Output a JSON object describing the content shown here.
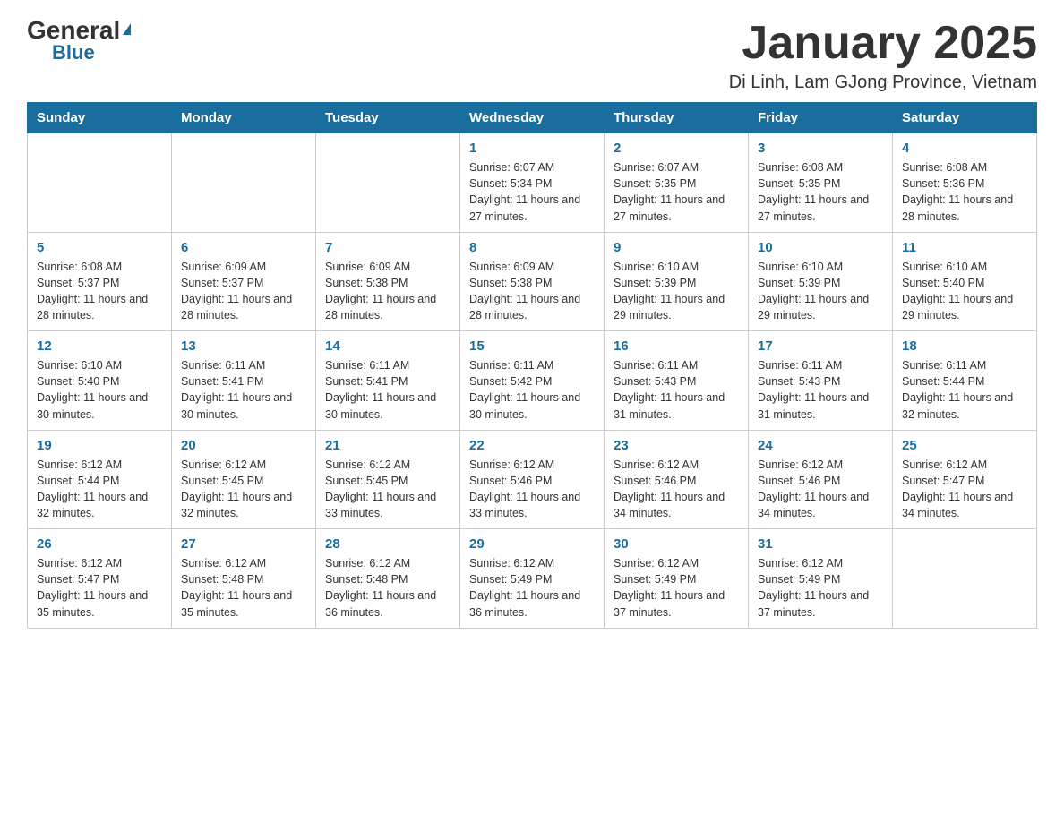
{
  "header": {
    "logo_general": "General",
    "logo_triangle": "▼",
    "logo_blue": "Blue",
    "main_title": "January 2025",
    "subtitle": "Di Linh, Lam GJong Province, Vietnam"
  },
  "calendar": {
    "days_of_week": [
      "Sunday",
      "Monday",
      "Tuesday",
      "Wednesday",
      "Thursday",
      "Friday",
      "Saturday"
    ],
    "weeks": [
      [
        {
          "day": "",
          "info": ""
        },
        {
          "day": "",
          "info": ""
        },
        {
          "day": "",
          "info": ""
        },
        {
          "day": "1",
          "info": "Sunrise: 6:07 AM\nSunset: 5:34 PM\nDaylight: 11 hours and 27 minutes."
        },
        {
          "day": "2",
          "info": "Sunrise: 6:07 AM\nSunset: 5:35 PM\nDaylight: 11 hours and 27 minutes."
        },
        {
          "day": "3",
          "info": "Sunrise: 6:08 AM\nSunset: 5:35 PM\nDaylight: 11 hours and 27 minutes."
        },
        {
          "day": "4",
          "info": "Sunrise: 6:08 AM\nSunset: 5:36 PM\nDaylight: 11 hours and 28 minutes."
        }
      ],
      [
        {
          "day": "5",
          "info": "Sunrise: 6:08 AM\nSunset: 5:37 PM\nDaylight: 11 hours and 28 minutes."
        },
        {
          "day": "6",
          "info": "Sunrise: 6:09 AM\nSunset: 5:37 PM\nDaylight: 11 hours and 28 minutes."
        },
        {
          "day": "7",
          "info": "Sunrise: 6:09 AM\nSunset: 5:38 PM\nDaylight: 11 hours and 28 minutes."
        },
        {
          "day": "8",
          "info": "Sunrise: 6:09 AM\nSunset: 5:38 PM\nDaylight: 11 hours and 28 minutes."
        },
        {
          "day": "9",
          "info": "Sunrise: 6:10 AM\nSunset: 5:39 PM\nDaylight: 11 hours and 29 minutes."
        },
        {
          "day": "10",
          "info": "Sunrise: 6:10 AM\nSunset: 5:39 PM\nDaylight: 11 hours and 29 minutes."
        },
        {
          "day": "11",
          "info": "Sunrise: 6:10 AM\nSunset: 5:40 PM\nDaylight: 11 hours and 29 minutes."
        }
      ],
      [
        {
          "day": "12",
          "info": "Sunrise: 6:10 AM\nSunset: 5:40 PM\nDaylight: 11 hours and 30 minutes."
        },
        {
          "day": "13",
          "info": "Sunrise: 6:11 AM\nSunset: 5:41 PM\nDaylight: 11 hours and 30 minutes."
        },
        {
          "day": "14",
          "info": "Sunrise: 6:11 AM\nSunset: 5:41 PM\nDaylight: 11 hours and 30 minutes."
        },
        {
          "day": "15",
          "info": "Sunrise: 6:11 AM\nSunset: 5:42 PM\nDaylight: 11 hours and 30 minutes."
        },
        {
          "day": "16",
          "info": "Sunrise: 6:11 AM\nSunset: 5:43 PM\nDaylight: 11 hours and 31 minutes."
        },
        {
          "day": "17",
          "info": "Sunrise: 6:11 AM\nSunset: 5:43 PM\nDaylight: 11 hours and 31 minutes."
        },
        {
          "day": "18",
          "info": "Sunrise: 6:11 AM\nSunset: 5:44 PM\nDaylight: 11 hours and 32 minutes."
        }
      ],
      [
        {
          "day": "19",
          "info": "Sunrise: 6:12 AM\nSunset: 5:44 PM\nDaylight: 11 hours and 32 minutes."
        },
        {
          "day": "20",
          "info": "Sunrise: 6:12 AM\nSunset: 5:45 PM\nDaylight: 11 hours and 32 minutes."
        },
        {
          "day": "21",
          "info": "Sunrise: 6:12 AM\nSunset: 5:45 PM\nDaylight: 11 hours and 33 minutes."
        },
        {
          "day": "22",
          "info": "Sunrise: 6:12 AM\nSunset: 5:46 PM\nDaylight: 11 hours and 33 minutes."
        },
        {
          "day": "23",
          "info": "Sunrise: 6:12 AM\nSunset: 5:46 PM\nDaylight: 11 hours and 34 minutes."
        },
        {
          "day": "24",
          "info": "Sunrise: 6:12 AM\nSunset: 5:46 PM\nDaylight: 11 hours and 34 minutes."
        },
        {
          "day": "25",
          "info": "Sunrise: 6:12 AM\nSunset: 5:47 PM\nDaylight: 11 hours and 34 minutes."
        }
      ],
      [
        {
          "day": "26",
          "info": "Sunrise: 6:12 AM\nSunset: 5:47 PM\nDaylight: 11 hours and 35 minutes."
        },
        {
          "day": "27",
          "info": "Sunrise: 6:12 AM\nSunset: 5:48 PM\nDaylight: 11 hours and 35 minutes."
        },
        {
          "day": "28",
          "info": "Sunrise: 6:12 AM\nSunset: 5:48 PM\nDaylight: 11 hours and 36 minutes."
        },
        {
          "day": "29",
          "info": "Sunrise: 6:12 AM\nSunset: 5:49 PM\nDaylight: 11 hours and 36 minutes."
        },
        {
          "day": "30",
          "info": "Sunrise: 6:12 AM\nSunset: 5:49 PM\nDaylight: 11 hours and 37 minutes."
        },
        {
          "day": "31",
          "info": "Sunrise: 6:12 AM\nSunset: 5:49 PM\nDaylight: 11 hours and 37 minutes."
        },
        {
          "day": "",
          "info": ""
        }
      ]
    ]
  }
}
